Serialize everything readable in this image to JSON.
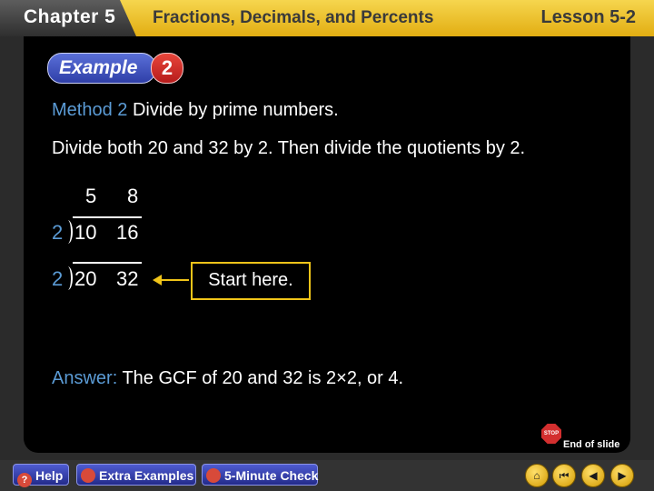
{
  "header": {
    "chapter": "Chapter 5",
    "title": "Fractions, Decimals, and Percents",
    "lesson": "Lesson 5-2"
  },
  "badge": {
    "label": "Example",
    "number": "2"
  },
  "method": {
    "label": "Method 2",
    "text": "Divide by prime numbers."
  },
  "instruction": "Divide both 20 and 32 by 2. Then divide the quotients by 2.",
  "ladder": {
    "top": [
      "5",
      "8"
    ],
    "middle": {
      "divisor": "2",
      "values": [
        "10",
        "16"
      ]
    },
    "bottom": {
      "divisor": "2",
      "values": [
        "20",
        "32"
      ]
    }
  },
  "callout": "Start here.",
  "answer": {
    "label": "Answer:",
    "text": "The GCF of 20 and 32 is 2×2, or 4."
  },
  "end_of_slide": {
    "stop": "STOP",
    "label": "End of slide"
  },
  "footer": {
    "help": "Help",
    "examples": "Extra Examples",
    "check": "5-Minute Check",
    "icons": {
      "help": "?",
      "menu": "⌂",
      "first": "⏮",
      "prev": "◀",
      "next": "▶"
    }
  },
  "colors": {
    "accent_blue": "#5b9bd5",
    "callout_border": "#f0c419",
    "header_gold": "#f6d64e"
  }
}
